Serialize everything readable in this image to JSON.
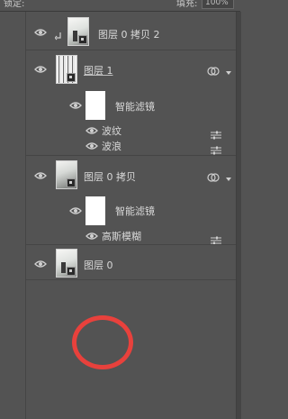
{
  "toolbar": {
    "label_left": "锁定:",
    "label_fill": "填充:",
    "fill_value": "100%"
  },
  "layers": [
    {
      "name": "图层 0 拷贝 2"
    },
    {
      "name": "图层 1",
      "smart_filter_label": "智能滤镜",
      "filters": [
        "波纹",
        "波浪"
      ]
    },
    {
      "name": "图层 0 拷贝",
      "smart_filter_label": "智能滤镜",
      "filters": [
        "高斯模糊"
      ]
    },
    {
      "name": "图层 0"
    }
  ],
  "annotation": {
    "color": "#e8413c"
  },
  "colors": {
    "panel_bg": "#535353",
    "separator": "#454545",
    "text": "#d8d8d8"
  }
}
